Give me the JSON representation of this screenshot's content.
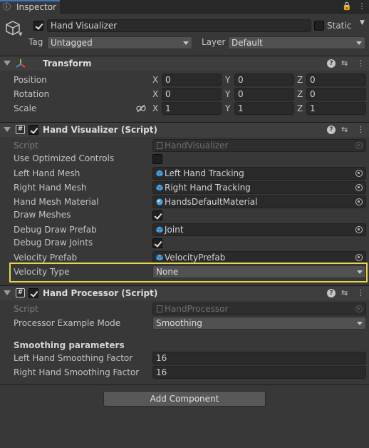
{
  "tab": {
    "label": "Inspector"
  },
  "header": {
    "name": "Hand Visualizer",
    "static_label": "Static",
    "tag_label": "Tag",
    "tag_value": "Untagged",
    "layer_label": "Layer",
    "layer_value": "Default"
  },
  "transform": {
    "title": "Transform",
    "rows": [
      {
        "label": "Position",
        "x": "0",
        "y": "0",
        "z": "0"
      },
      {
        "label": "Rotation",
        "x": "0",
        "y": "0",
        "z": "0"
      },
      {
        "label": "Scale",
        "x": "1",
        "y": "1",
        "z": "1"
      }
    ],
    "axis": {
      "x": "X",
      "y": "Y",
      "z": "Z"
    }
  },
  "hand_visualizer": {
    "title": "Hand Visualizer (Script)",
    "script_label": "Script",
    "script_value": "HandVisualizer",
    "use_optimized_label": "Use Optimized Controls",
    "left_mesh_label": "Left Hand Mesh",
    "left_mesh_value": "Left Hand Tracking",
    "right_mesh_label": "Right Hand Mesh",
    "right_mesh_value": "Right Hand Tracking",
    "material_label": "Hand Mesh Material",
    "material_value": "HandsDefaultMaterial",
    "draw_meshes_label": "Draw Meshes",
    "debug_prefab_label": "Debug Draw Prefab",
    "debug_prefab_value": "Joint",
    "debug_joints_label": "Debug Draw Joints",
    "velocity_prefab_label": "Velocity Prefab",
    "velocity_prefab_value": "VelocityPrefab",
    "velocity_type_label": "Velocity Type",
    "velocity_type_value": "None"
  },
  "hand_processor": {
    "title": "Hand Processor (Script)",
    "script_label": "Script",
    "script_value": "HandProcessor",
    "mode_label": "Processor Example Mode",
    "mode_value": "Smoothing",
    "section_label": "Smoothing parameters",
    "left_factor_label": "Left Hand Smoothing Factor",
    "left_factor_value": "16",
    "right_factor_label": "Right Hand Smoothing Factor",
    "right_factor_value": "16"
  },
  "add_component_label": "Add Component",
  "colors": {
    "background": "#383838",
    "highlight": "#e8d44d",
    "tab_accent": "#3a79bb"
  }
}
